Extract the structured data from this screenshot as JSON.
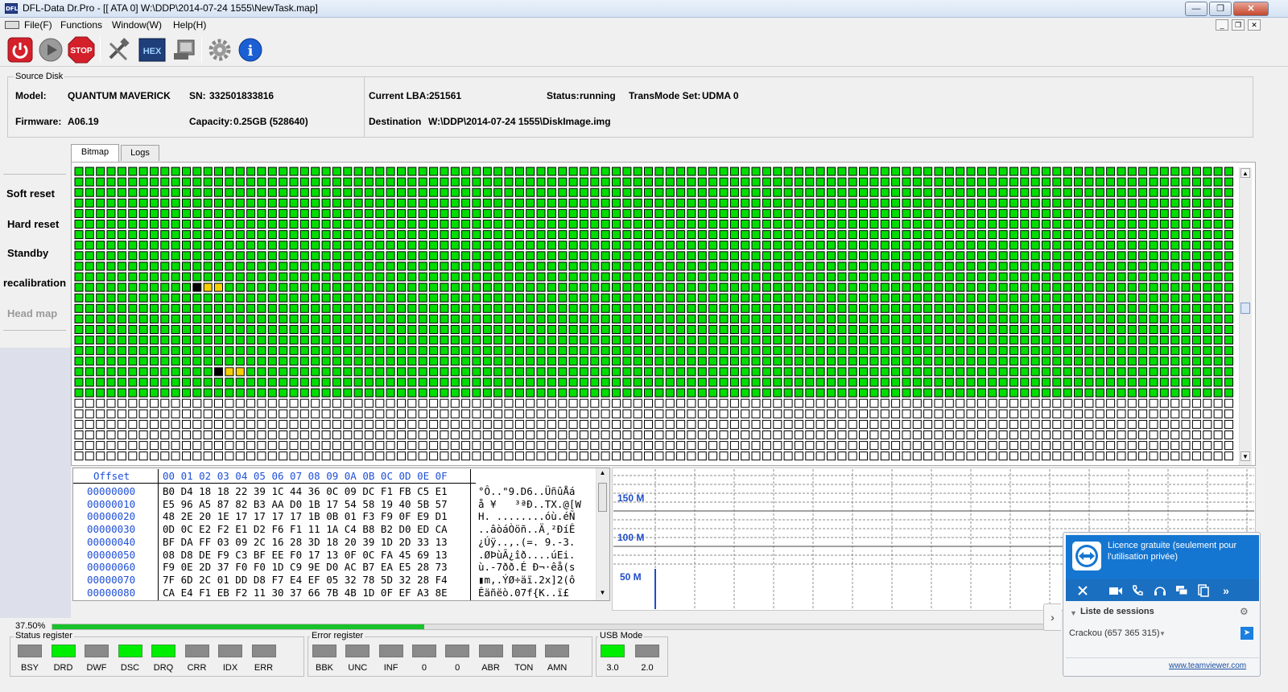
{
  "window": {
    "title": "DFL-Data Dr.Pro - [[ ATA 0]  W:\\DDP\\2014-07-24 1555\\NewTask.map]",
    "app_icon_text": "DFL",
    "controls": [
      "minimize-icon",
      "restore-icon",
      "close-icon"
    ]
  },
  "menu": {
    "items": [
      "File(F)",
      "Functions",
      "Window(W)",
      "Help(H)"
    ]
  },
  "toolbar": {
    "buttons": [
      {
        "name": "power-button",
        "icon": "power-icon",
        "color": "#d4202a"
      },
      {
        "name": "play-button",
        "icon": "play-icon",
        "color": "#8a8a8a"
      },
      {
        "name": "stop-button",
        "icon": "stop-sign-icon",
        "label": "STOP",
        "color": "#d4202a"
      },
      {
        "name": "tools-button",
        "icon": "tools-icon"
      },
      {
        "name": "hex-button",
        "icon": "hex-icon",
        "label": "HEX",
        "color": "#1f3f7a"
      },
      {
        "name": "terminal-button",
        "icon": "terminal-icon"
      },
      {
        "name": "settings-button",
        "icon": "gear-icon"
      },
      {
        "name": "info-button",
        "icon": "info-icon",
        "label": "i",
        "color": "#1b5fd4"
      }
    ]
  },
  "source_disk": {
    "group_title": "Source Disk",
    "model_label": "Model:",
    "model_value": "QUANTUM MAVERICK",
    "sn_label": "SN:",
    "sn_value": "332501833816",
    "firmware_label": "Firmware:",
    "firmware_value": "A06.19",
    "capacity_label": "Capacity:",
    "capacity_value": "0.25GB (528640)",
    "current_lba_label": "Current LBA:",
    "current_lba_value": "251561",
    "status_label": "Status:",
    "status_value": "running",
    "transmode_label": "TransMode Set:",
    "transmode_value": "UDMA 0",
    "destination_label": "Destination",
    "destination_value": "W:\\DDP\\2014-07-24 1555\\DiskImage.img"
  },
  "sidebar": {
    "items": [
      {
        "label": "Soft reset",
        "enabled": true
      },
      {
        "label": "Hard reset",
        "enabled": true
      },
      {
        "label": "Standby",
        "enabled": true
      },
      {
        "label": "recalibration",
        "enabled": true
      },
      {
        "label": "Head map",
        "enabled": false
      }
    ]
  },
  "tabs": {
    "bitmap": "Bitmap",
    "logs": "Logs",
    "active": "Bitmap"
  },
  "bitmap": {
    "columns": 108,
    "rows": 28,
    "filled_rows": 22,
    "filled_last_row_partial_cols": 0,
    "cell_states": {
      "read": "#00dd00",
      "pending": "#ffffff",
      "bad": "#000000",
      "slow": "#ffd400"
    },
    "colors": {
      "read": "#00dd00",
      "empty": "#ffffff",
      "bad": "#000000",
      "slow": "#f5d000"
    },
    "markers": [
      {
        "row": 11,
        "col": 11,
        "state": "bad"
      },
      {
        "row": 11,
        "col": 12,
        "state": "slow"
      },
      {
        "row": 11,
        "col": 13,
        "state": "slow"
      },
      {
        "row": 19,
        "col": 13,
        "state": "bad"
      },
      {
        "row": 19,
        "col": 14,
        "state": "slow"
      },
      {
        "row": 19,
        "col": 15,
        "state": "slow"
      }
    ]
  },
  "hex": {
    "offset_header": "Offset",
    "column_header": "00 01 02 03 04 05 06 07 08 09 0A 0B 0C 0D 0E 0F",
    "rows": [
      {
        "offset": "00000000",
        "bytes": "B0 D4 18 18 22 39 1C 44 36 0C 09 DC F1 FB C5 E1",
        "ascii": "°Ô..\"9.D6..ÜñûÅá"
      },
      {
        "offset": "00000010",
        "bytes": "E5 96 A5 87 82 B3 AA D0 1B 17 54 58 19 40 5B 57",
        "ascii": "å ¥   ³ªÐ..TX.@[W"
      },
      {
        "offset": "00000020",
        "bytes": "48 2E 20 1E 17 17 17 17 1B 0B 01 F3 F9 0F E9 D1",
        "ascii": "H. ........óù.éÑ"
      },
      {
        "offset": "00000030",
        "bytes": "0D 0C E2 F2 E1 D2 F6 F1 11 1A C4 B8 B2 D0 ED CA",
        "ascii": "..âòáÒöñ..Ä¸²ÐíÊ"
      },
      {
        "offset": "00000040",
        "bytes": "BF DA FF 03 09 2C 16 28 3D 18 20 39 1D 2D 33 13",
        "ascii": "¿Úÿ..,.(=. 9.-3."
      },
      {
        "offset": "00000050",
        "bytes": "08 D8 DE F9 C3 BF EE F0 17 13 0F 0C FA 45 69 13",
        "ascii": ".ØÞùÃ¿îð....úEi."
      },
      {
        "offset": "00000060",
        "bytes": "F9 0E 2D 37 F0 F0 1D C9 9E D0 AC B7 EA E5 28 73",
        "ascii": "ù.-7ðð.É Ð¬·êå(s"
      },
      {
        "offset": "00000070",
        "bytes": "7F 6D 2C 01 DD D8 F7 E4 EF 05 32 78 5D 32 28 F4",
        "ascii": "▮m,.ÝØ÷äï.2x]2(ô"
      },
      {
        "offset": "00000080",
        "bytes": "CA E4 F1 EB F2 11 30 37 66 7B 4B 1D 0F EF A3 8E",
        "ascii": "Êäñëò.07f{K..ï£ "
      }
    ]
  },
  "graph": {
    "labels": [
      "150 M",
      "100 M",
      "50 M"
    ]
  },
  "progress": {
    "label": "37.50%",
    "value": 0.375
  },
  "status_register": {
    "title": "Status register",
    "leds": [
      {
        "label": "BSY",
        "on": false
      },
      {
        "label": "DRD",
        "on": true
      },
      {
        "label": "DWF",
        "on": false
      },
      {
        "label": "DSC",
        "on": true
      },
      {
        "label": "DRQ",
        "on": true
      },
      {
        "label": "CRR",
        "on": false
      },
      {
        "label": "IDX",
        "on": false
      },
      {
        "label": "ERR",
        "on": false
      }
    ]
  },
  "error_register": {
    "title": "Error register",
    "leds": [
      {
        "label": "BBK",
        "on": false
      },
      {
        "label": "UNC",
        "on": false
      },
      {
        "label": "INF",
        "on": false
      },
      {
        "label": "0",
        "on": false
      },
      {
        "label": "0",
        "on": false
      },
      {
        "label": "ABR",
        "on": false
      },
      {
        "label": "TON",
        "on": false
      },
      {
        "label": "AMN",
        "on": false
      }
    ]
  },
  "usb_mode": {
    "title": "USB Mode",
    "leds": [
      {
        "label": "3.0",
        "on": true
      },
      {
        "label": "2.0",
        "on": false
      }
    ]
  },
  "teamviewer": {
    "title": "Licence gratuite (seulement pour l'utilisation privée)",
    "sessions_title": "Liste de sessions",
    "session_item": "Crackou (657 365 315)",
    "link": "www.teamviewer.com",
    "accent": "#1576d1"
  }
}
